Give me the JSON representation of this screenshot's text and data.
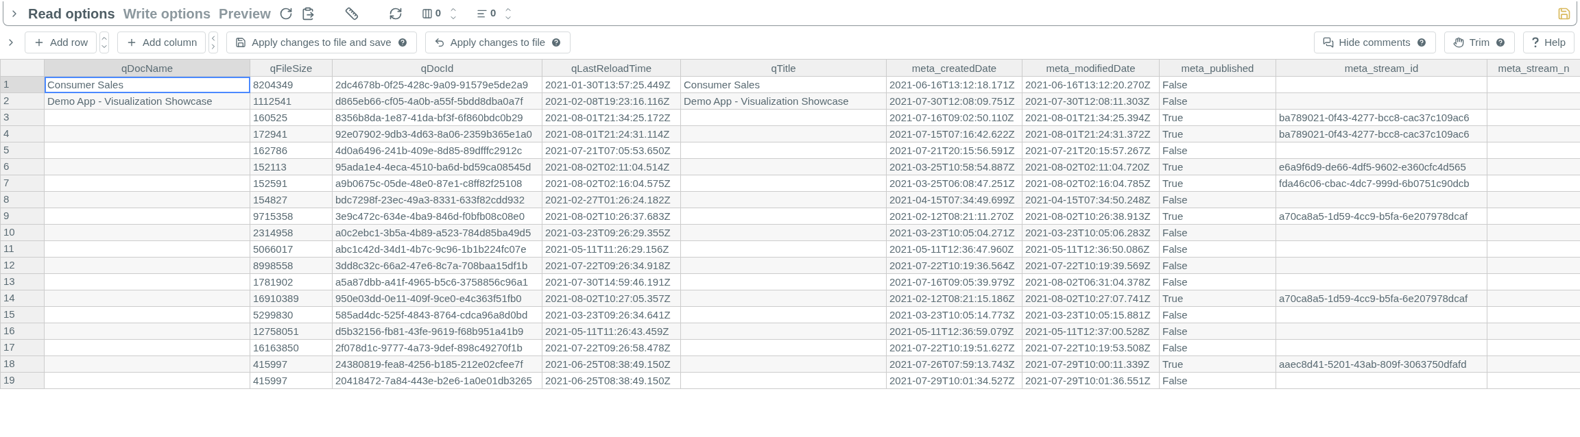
{
  "tabs": [
    {
      "label": "Read options",
      "selected": true
    },
    {
      "label": "Write options",
      "selected": false
    },
    {
      "label": "Preview",
      "selected": false
    }
  ],
  "counters": [
    {
      "kind": "columns",
      "value": "0"
    },
    {
      "kind": "rows",
      "value": "0"
    }
  ],
  "actions": [
    {
      "kind": "add-row",
      "label": "Add row"
    },
    {
      "kind": "add-column",
      "label": "Add column"
    },
    {
      "kind": "apply-save",
      "label": "Apply changes to file and save"
    },
    {
      "kind": "apply",
      "label": "Apply changes to file"
    },
    {
      "kind": "comments",
      "label": "Hide comments"
    },
    {
      "kind": "trim",
      "label": "Trim"
    },
    {
      "kind": "help",
      "label": "Help"
    }
  ],
  "table": {
    "columns": [
      {
        "label": "qDocName",
        "selected": true
      },
      {
        "label": "qFileSize",
        "selected": false
      },
      {
        "label": "qDocId",
        "selected": false
      },
      {
        "label": "qLastReloadTime",
        "selected": false
      },
      {
        "label": "qTitle",
        "selected": false
      },
      {
        "label": "meta_createdDate",
        "selected": false
      },
      {
        "label": "meta_modifiedDate",
        "selected": false
      },
      {
        "label": "meta_published",
        "selected": false
      },
      {
        "label": "meta_stream_id",
        "selected": false
      },
      {
        "label": "meta_stream_n",
        "selected": false
      }
    ],
    "rows": [
      {
        "number": "1",
        "selected": true,
        "cells": [
          "Consumer Sales",
          "8204349",
          "2dc4678b-0f25-428c-9a09-91579e5de2a9",
          "2021-01-30T13:57:25.449Z",
          "Consumer Sales",
          "2021-06-16T13:12:18.171Z",
          "2021-06-16T13:12:20.270Z",
          "False",
          null,
          null
        ]
      },
      {
        "number": "2",
        "selected": false,
        "cells": [
          "Demo App - Visualization Showcase",
          "1112541",
          "d865eb66-cf05-4a0b-a55f-5bdd8dba0a7f",
          "2021-02-08T19:23:16.116Z",
          "Demo App - Visualization Showcase",
          "2021-07-30T12:08:09.751Z",
          "2021-07-30T12:08:11.303Z",
          "False",
          null,
          null
        ]
      },
      {
        "number": "3",
        "selected": false,
        "cells": [
          null,
          "160525",
          "8356b8da-1e87-41da-bf3f-6f860bdc0b29",
          "2021-08-01T21:34:25.172Z",
          null,
          "2021-07-16T09:02:50.110Z",
          "2021-08-01T21:34:25.394Z",
          "True",
          "ba789021-0f43-4277-bcc8-cac37c109ac6",
          null
        ]
      },
      {
        "number": "4",
        "selected": false,
        "cells": [
          null,
          "172941",
          "92e07902-9db3-4d63-8a06-2359b365e1a0",
          "2021-08-01T21:24:31.114Z",
          null,
          "2021-07-15T07:16:42.622Z",
          "2021-08-01T21:24:31.372Z",
          "True",
          "ba789021-0f43-4277-bcc8-cac37c109ac6",
          null
        ]
      },
      {
        "number": "5",
        "selected": false,
        "cells": [
          null,
          "162786",
          "4d0a6496-241b-409e-8d85-89dfffc2912c",
          "2021-07-21T07:05:53.650Z",
          null,
          "2021-07-21T20:15:56.591Z",
          "2021-07-21T20:15:57.267Z",
          "False",
          null,
          null
        ]
      },
      {
        "number": "6",
        "selected": false,
        "cells": [
          null,
          "152113",
          "95ada1e4-4eca-4510-ba6d-bd59ca08545d",
          "2021-08-02T02:11:04.514Z",
          null,
          "2021-03-25T10:58:54.887Z",
          "2021-08-02T02:11:04.720Z",
          "True",
          "e6a9f6d9-de66-4df5-9602-e360cfc4d565",
          null
        ]
      },
      {
        "number": "7",
        "selected": false,
        "cells": [
          null,
          "152591",
          "a9b0675c-05de-48e0-87e1-c8ff82f25108",
          "2021-08-02T02:16:04.575Z",
          null,
          "2021-03-25T06:08:47.251Z",
          "2021-08-02T02:16:04.785Z",
          "True",
          "fda46c06-cbac-4dc7-999d-6b0751c90dcb",
          null
        ]
      },
      {
        "number": "8",
        "selected": false,
        "cells": [
          null,
          "154827",
          "bdc7298f-23ec-49a3-8331-633f82cdd932",
          "2021-02-27T01:26:24.182Z",
          null,
          "2021-04-15T07:34:49.699Z",
          "2021-04-15T07:34:50.248Z",
          "False",
          null,
          null
        ]
      },
      {
        "number": "9",
        "selected": false,
        "cells": [
          null,
          "9715358",
          "3e9c472c-634e-4ba9-846d-f0bfb08c08e0",
          "2021-08-02T10:26:37.683Z",
          null,
          "2021-02-12T08:21:11.270Z",
          "2021-08-02T10:26:38.913Z",
          "True",
          "a70ca8a5-1d59-4cc9-b5fa-6e207978dcaf",
          null
        ]
      },
      {
        "number": "10",
        "selected": false,
        "cells": [
          null,
          "2314958",
          "a0c2ebc1-3b5a-4b89-a523-784d85ba49d5",
          "2021-03-23T09:26:29.355Z",
          null,
          "2021-03-23T10:05:04.271Z",
          "2021-03-23T10:05:06.283Z",
          "False",
          null,
          null
        ]
      },
      {
        "number": "11",
        "selected": false,
        "cells": [
          null,
          "5066017",
          "abc1c42d-34d1-4b7c-9c96-1b1b224fc07e",
          "2021-05-11T11:26:29.156Z",
          null,
          "2021-05-11T12:36:47.960Z",
          "2021-05-11T12:36:50.086Z",
          "False",
          null,
          null
        ]
      },
      {
        "number": "12",
        "selected": false,
        "cells": [
          null,
          "8998558",
          "3dd8c32c-66a2-47e6-8c7a-708baa15df1b",
          "2021-07-22T09:26:34.918Z",
          null,
          "2021-07-22T10:19:36.564Z",
          "2021-07-22T10:19:39.569Z",
          "False",
          null,
          null
        ]
      },
      {
        "number": "13",
        "selected": false,
        "cells": [
          null,
          "1781902",
          "a5a87dbb-a41f-4965-b5c6-3758856c96a1",
          "2021-07-30T14:59:46.191Z",
          null,
          "2021-07-16T09:05:39.979Z",
          "2021-08-02T06:31:04.378Z",
          "False",
          null,
          null
        ]
      },
      {
        "number": "14",
        "selected": false,
        "cells": [
          null,
          "16910389",
          "950e03dd-0e11-409f-9ce0-e4c363f51fb0",
          "2021-08-02T10:27:05.357Z",
          null,
          "2021-02-12T08:21:15.186Z",
          "2021-08-02T10:27:07.741Z",
          "True",
          "a70ca8a5-1d59-4cc9-b5fa-6e207978dcaf",
          null
        ]
      },
      {
        "number": "15",
        "selected": false,
        "cells": [
          null,
          "5299830",
          "585ad4dc-525f-4843-8764-cdca96a8d0bd",
          "2021-03-23T09:26:34.641Z",
          null,
          "2021-03-23T10:05:14.773Z",
          "2021-03-23T10:05:15.881Z",
          "False",
          null,
          null
        ]
      },
      {
        "number": "16",
        "selected": false,
        "cells": [
          null,
          "12758051",
          "d5b32156-fb81-43fe-9619-f68b951a41b9",
          "2021-05-11T11:26:43.459Z",
          null,
          "2021-05-11T12:36:59.079Z",
          "2021-05-11T12:37:00.528Z",
          "False",
          null,
          null
        ]
      },
      {
        "number": "17",
        "selected": false,
        "cells": [
          null,
          "16163850",
          "2f078d1c-9777-4a73-9def-898c49270f1b",
          "2021-07-22T09:26:58.478Z",
          null,
          "2021-07-22T10:19:51.627Z",
          "2021-07-22T10:19:53.508Z",
          "False",
          null,
          null
        ]
      },
      {
        "number": "18",
        "selected": false,
        "cells": [
          null,
          "415997",
          "24380819-fea8-4256-b185-212e02cfee7f",
          "2021-06-25T08:38:49.150Z",
          null,
          "2021-07-26T07:59:13.743Z",
          "2021-07-29T10:00:11.339Z",
          "True",
          "aaec8d41-5201-43ab-809f-3063750dfafd",
          null
        ]
      },
      {
        "number": "19",
        "selected": false,
        "cells": [
          null,
          "415997",
          "20418472-7a84-443e-b2e6-1a0e01db3265",
          "2021-06-25T08:38:49.150Z",
          null,
          "2021-07-29T10:01:34.527Z",
          "2021-07-29T10:01:36.551Z",
          "False",
          null,
          null
        ]
      }
    ]
  }
}
